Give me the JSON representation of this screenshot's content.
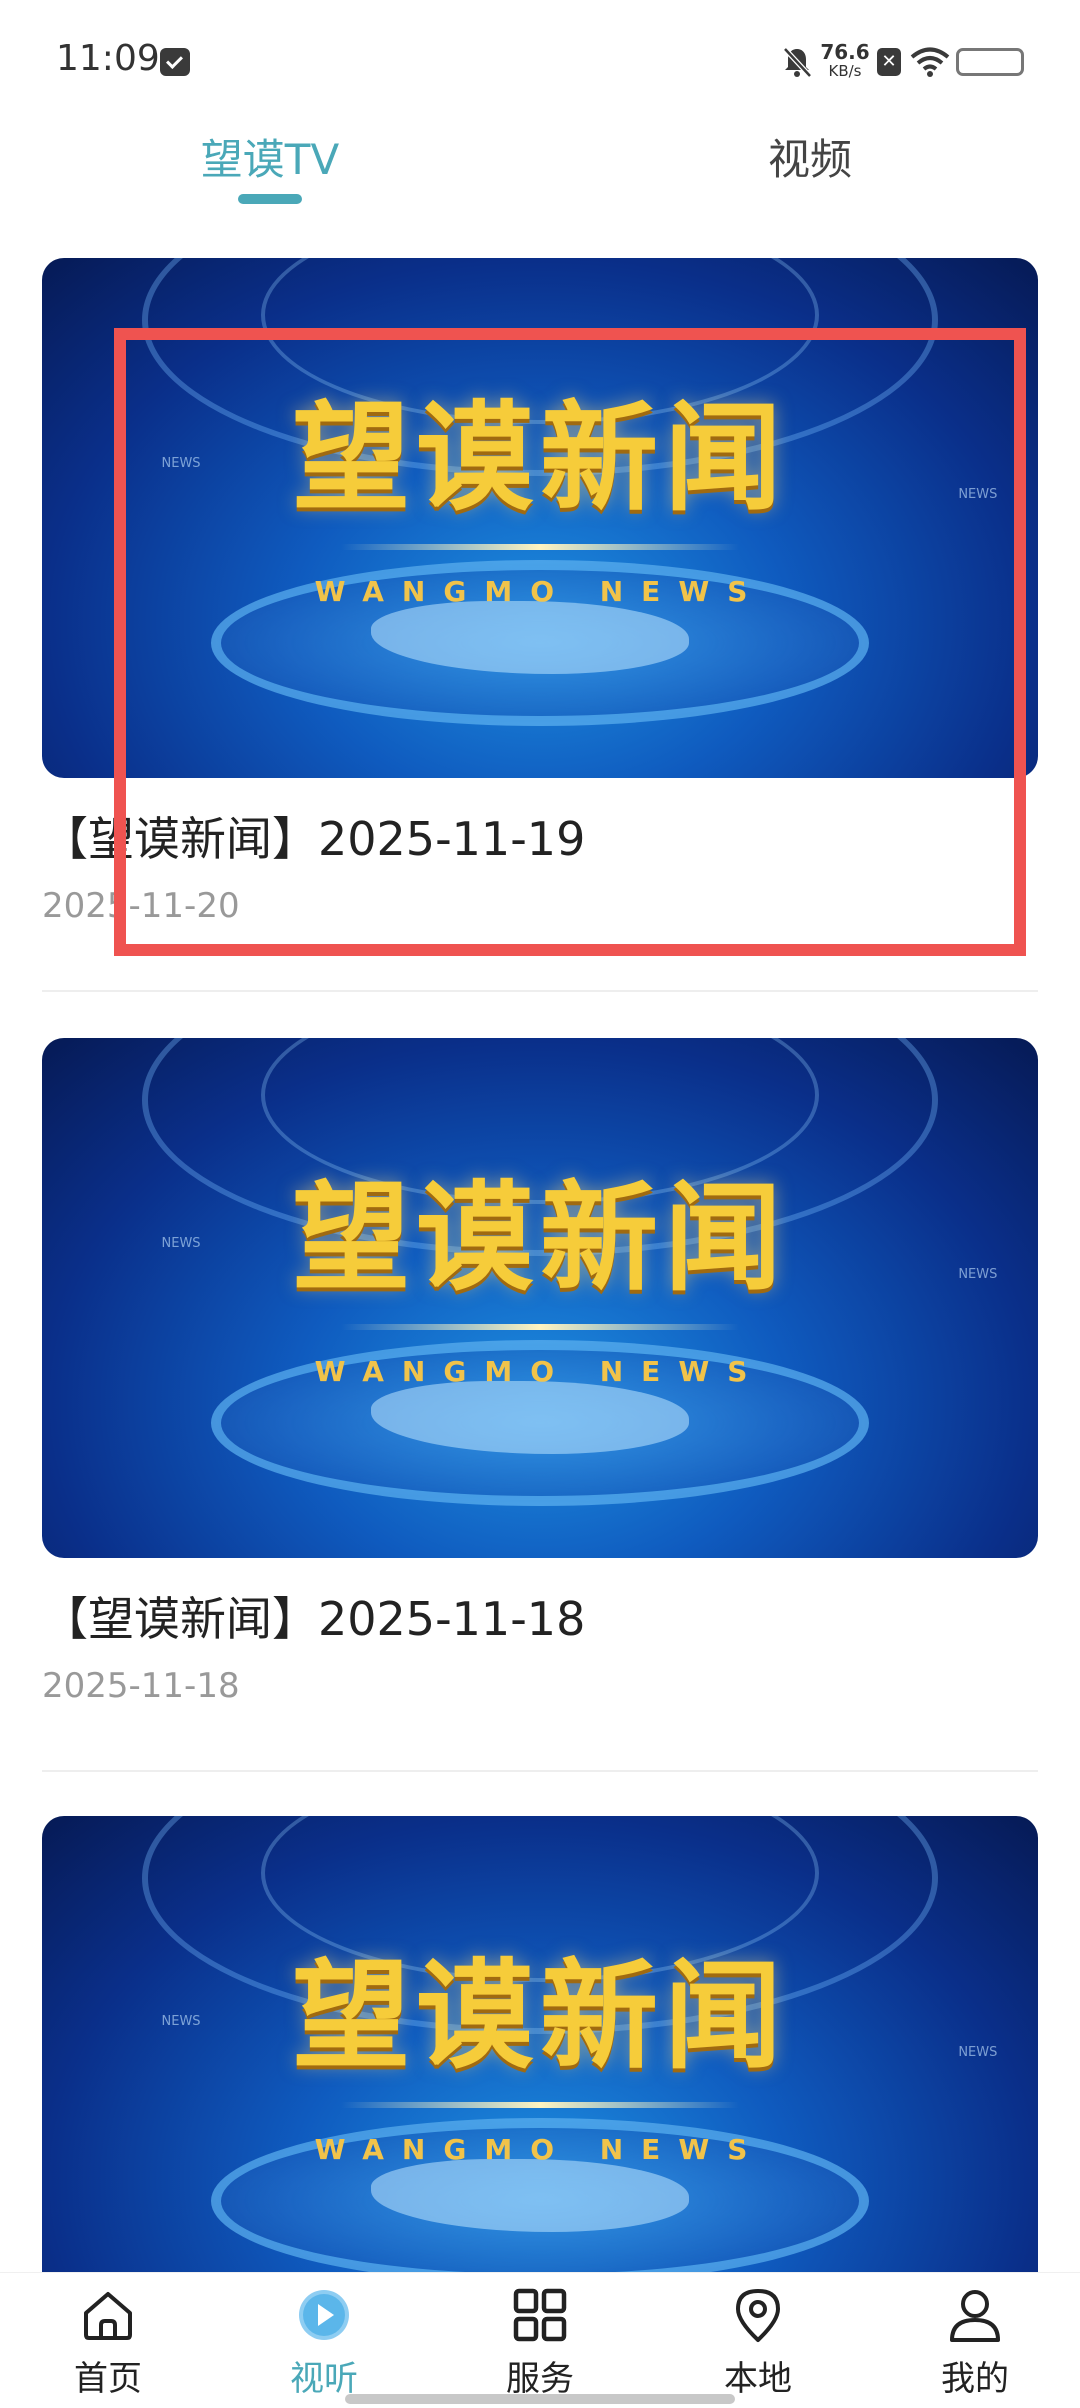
{
  "status_bar": {
    "time": "11:09",
    "net_speed_value": "76.6",
    "net_speed_unit": "KB/s",
    "sim_label": "✕"
  },
  "tabs": [
    {
      "label": "望谟TV",
      "active": true
    },
    {
      "label": "视频",
      "active": false
    }
  ],
  "thumbnail": {
    "logo_text": "望谟新闻",
    "logo_sub": "WANGMO NEWS",
    "tag": "NEWS"
  },
  "news_items": [
    {
      "title": "【望谟新闻】2025-11-19",
      "date": "2025-11-20"
    },
    {
      "title": "【望谟新闻】2025-11-18",
      "date": "2025-11-18"
    },
    {
      "title": "",
      "date": ""
    }
  ],
  "bottom_nav": [
    {
      "label": "首页",
      "icon": "home-icon",
      "active": false
    },
    {
      "label": "视听",
      "icon": "play-circle-icon",
      "active": true
    },
    {
      "label": "服务",
      "icon": "grid-icon",
      "active": false
    },
    {
      "label": "本地",
      "icon": "location-pin-icon",
      "active": false
    },
    {
      "label": "我的",
      "icon": "user-icon",
      "active": false
    }
  ],
  "colors": {
    "accent": "#4aa8b8",
    "highlight": "#ef5350"
  }
}
